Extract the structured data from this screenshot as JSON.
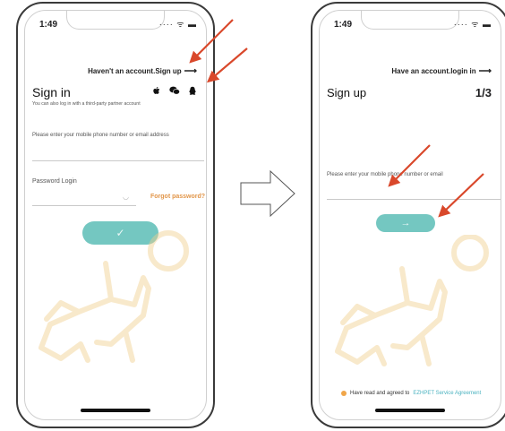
{
  "left": {
    "status_time": "1:49",
    "status_icons": "···· ᯤ ▬",
    "top_link": "Haven't an account.Sign up",
    "top_link_arrow": "⟶",
    "title": "Sign in",
    "subnote": "You can also log in with a third-party partner account",
    "social_icons": [
      "apple-icon",
      "wechat-icon",
      "qq-icon"
    ],
    "phone_label": "Please enter your mobile phone number or email address",
    "phone_value": "",
    "password_label": "Password Login",
    "password_value": "",
    "forgot": "Forgot password?",
    "submit_icon": "✓"
  },
  "right": {
    "status_time": "1:49",
    "status_icons": "···· ᯤ ▬",
    "top_link": "Have an account.login in",
    "top_link_arrow": "⟶",
    "title": "Sign up",
    "step": "1/3",
    "phone_label": "Please enter your mobile phone number or email",
    "phone_value": "",
    "next_icon": "→",
    "agree_text": "Have read and agreed to",
    "agree_link": "EZHPET Service Agreement"
  },
  "colors": {
    "accent": "#74c7c1",
    "warning": "#e2964a",
    "annotation": "#d9482b",
    "watermark": "#f6e2b8"
  }
}
